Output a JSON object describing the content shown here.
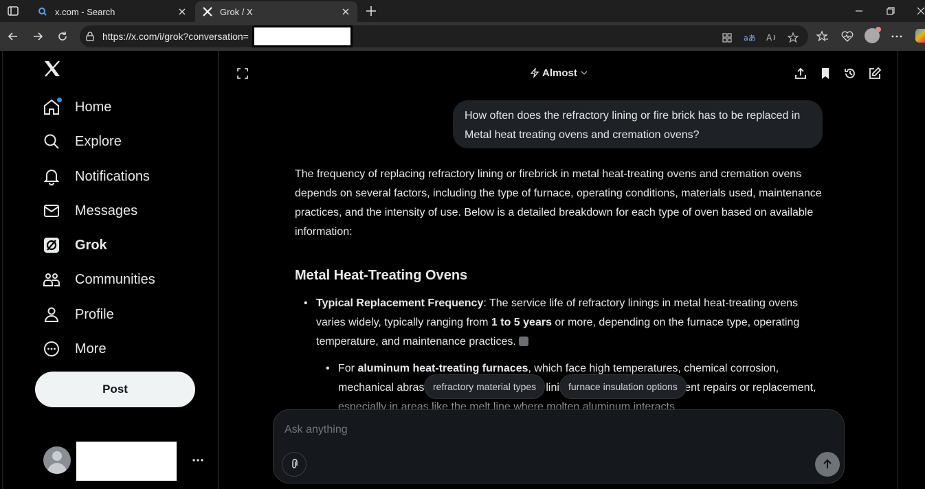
{
  "browser": {
    "tabs": [
      {
        "title": "x.com - Search",
        "active": false
      },
      {
        "title": "Grok / X",
        "active": true
      }
    ],
    "url": "https://x.com/i/grok?conversation="
  },
  "sidebar": {
    "items": [
      {
        "label": "Home",
        "icon": "home-icon"
      },
      {
        "label": "Explore",
        "icon": "search-icon"
      },
      {
        "label": "Notifications",
        "icon": "bell-icon"
      },
      {
        "label": "Messages",
        "icon": "mail-icon"
      },
      {
        "label": "Grok",
        "icon": "grok-icon"
      },
      {
        "label": "Communities",
        "icon": "communities-icon"
      },
      {
        "label": "Profile",
        "icon": "person-icon"
      },
      {
        "label": "More",
        "icon": "more-circle-icon"
      }
    ],
    "post_label": "Post"
  },
  "header": {
    "model_label": "Almost"
  },
  "conversation": {
    "user_message": "How often does the refractory lining or fire brick has to be replaced in Metal heat treating ovens and cremation ovens?",
    "intro": "The frequency of replacing refractory lining or firebrick in metal heat-treating ovens and cremation ovens depends on several factors, including the type of furnace, operating conditions, materials used, maintenance practices, and the intensity of use. Below is a detailed breakdown for each type of oven based on available information:",
    "section_heading": "Metal Heat-Treating Ovens",
    "bullet1": {
      "label": "Typical Replacement Frequency",
      "text_a": ": The service life of refractory linings in metal heat-treating ovens varies widely, typically ranging from ",
      "emph": "1 to 5 years",
      "text_b": " or more, depending on the furnace type, operating temperature, and maintenance practices."
    },
    "bullet2": {
      "prefix": "For ",
      "label": "aluminum heat-treating furnaces",
      "text": ", which face high temperatures, chemical corrosion, mechanical abrasion, and thermal cycling, linings may need more frequent repairs or replacement, especially in areas like the melt line where molten aluminum interacts"
    }
  },
  "suggestions": [
    {
      "label": "refractory material types"
    },
    {
      "label": "furnace insulation options"
    }
  ],
  "composer": {
    "placeholder": "Ask anything"
  }
}
